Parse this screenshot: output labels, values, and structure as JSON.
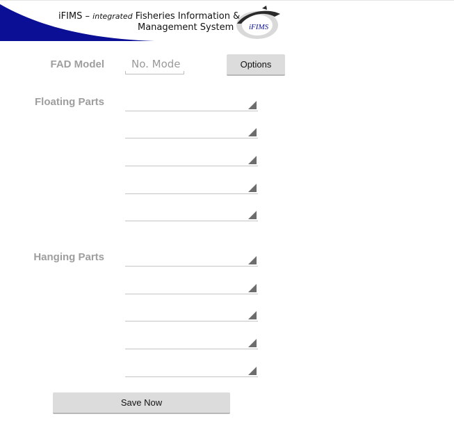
{
  "header": {
    "brand": "iFIMS",
    "dash": " – ",
    "tagline_italic": "integrated",
    "title_line1_rest": " Fisheries Information &",
    "title_line2": "Management System",
    "logo_text": "iFIMS",
    "colors": {
      "swoosh": "#0b0f96"
    }
  },
  "form": {
    "fad_model_label": "FAD Model",
    "model_placeholder": "No. Mode",
    "options_button": "Options",
    "floating_parts_label": "Floating Parts",
    "hanging_parts_label": "Hanging Parts",
    "floating_parts_values": [
      "",
      "",
      "",
      "",
      ""
    ],
    "hanging_parts_values": [
      "",
      "",
      "",
      "",
      ""
    ],
    "save_button": "Save Now"
  }
}
